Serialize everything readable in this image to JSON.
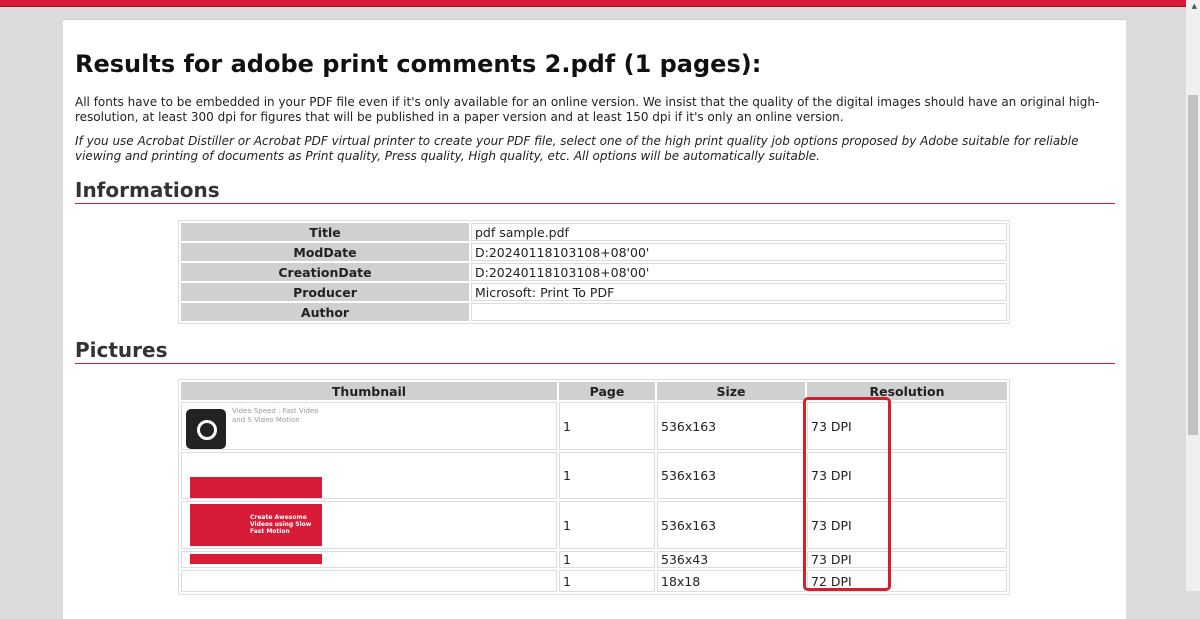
{
  "title": "Results for adobe print comments 2.pdf (1 pages):",
  "para1": "All fonts have to be embedded in your PDF file even if it's only available for an online version. We insist that the quality of the digital images should have an original high-resolution, at least 300 dpi for figures that will be published in a paper version and at least 150 dpi if it's only an online version.",
  "para2": "If you use Acrobat Distiller or Acrobat PDF virtual printer to create your PDF file, select one of the high print quality job options proposed by Adobe suitable for reliable viewing and printing of documents as Print quality, Press quality, High quality, etc. All options will be automatically suitable.",
  "info_heading": "Informations",
  "info": [
    {
      "k": "Title",
      "v": "pdf sample.pdf"
    },
    {
      "k": "ModDate",
      "v": "D:20240118103108+08'00'"
    },
    {
      "k": "CreationDate",
      "v": "D:20240118103108+08'00'"
    },
    {
      "k": "Producer",
      "v": "Microsoft: Print To PDF"
    },
    {
      "k": "Author",
      "v": ""
    }
  ],
  "pictures_heading": "Pictures",
  "pic_headers": [
    "Thumbnail",
    "Page",
    "Size",
    "Resolution"
  ],
  "thumb_text": {
    "app": "Video Speed : Fast Video and S Video Motion",
    "banner": "Create Awesome Videos using Slow Fast Motion"
  },
  "pictures": [
    {
      "page": "1",
      "size": "536x163",
      "res": "73 DPI"
    },
    {
      "page": "1",
      "size": "536x163",
      "res": "73 DPI"
    },
    {
      "page": "1",
      "size": "536x163",
      "res": "73 DPI"
    },
    {
      "page": "1",
      "size": "536x43",
      "res": "73 DPI"
    },
    {
      "page": "1",
      "size": "18x18",
      "res": "72 DPI"
    }
  ]
}
